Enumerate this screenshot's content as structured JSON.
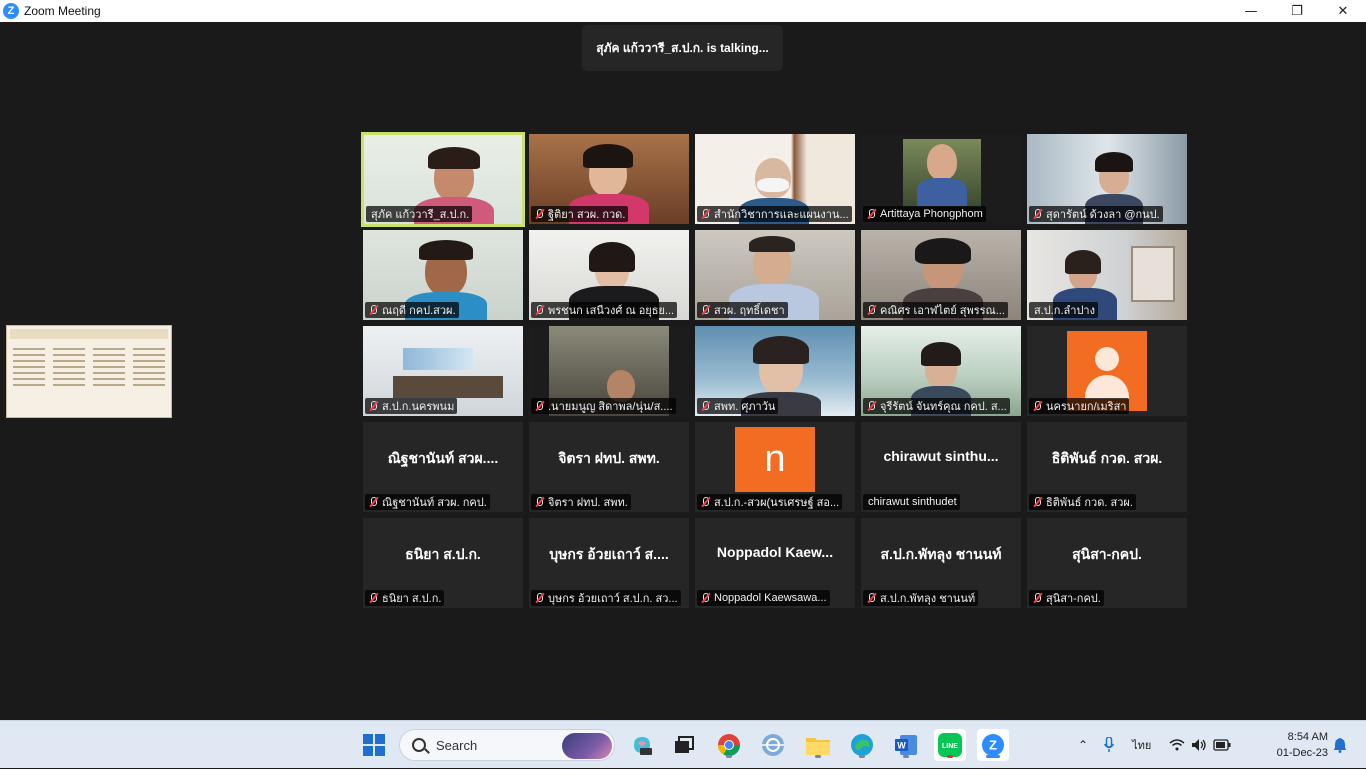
{
  "window": {
    "title": "Zoom Meeting",
    "app_icon_letter": "Z"
  },
  "window_controls": {
    "minimize": "—",
    "maximize": "❐",
    "close": "✕"
  },
  "talking_banner": "สุภัค แก้ววารี_ส.ป.ก. is  talking...",
  "tiles": [
    {
      "name": "สุภัค แก้ววารี_ส.ป.ก.",
      "active": true,
      "muted": false
    },
    {
      "name": "ฐิติยา สวผ. กวด.",
      "muted": true
    },
    {
      "name": "สำนักวิชาการและแผนงาน...",
      "muted": true
    },
    {
      "name": "Artittaya Phongphom",
      "muted": true
    },
    {
      "name": "สุดารัตน์ ด้วงลา @กนป.",
      "muted": true
    },
    {
      "name": "ณฤดี กคป.สวผ.",
      "muted": true
    },
    {
      "name": "พรชนก เสนีวงศ์ ณ อยุธย...",
      "muted": true
    },
    {
      "name": "สวผ. ฤทธิ์เดชา",
      "muted": true
    },
    {
      "name": "คณิศร  เอาฬไตย์ สุพรรณ...",
      "muted": true
    },
    {
      "name": "ส.ป.ก.ลำปาง",
      "muted": false
    },
    {
      "name": "ส.ป.ก.นครพนม",
      "muted": true
    },
    {
      "name": ".นายมนูญ สิดาพล/นุ่น/ส....",
      "muted": true
    },
    {
      "name": "สพท. ศุภาวัน",
      "muted": true
    },
    {
      "name": "จุรีรัตน์ จันทร์คุณ กคป. ส...",
      "muted": true
    },
    {
      "name": "นครนายก/เมริสา",
      "muted": true
    },
    {
      "big": "ณิฐชานันท์ สวผ....",
      "name": "ณิฐชานันท์ สวผ. กคป.",
      "muted": true
    },
    {
      "big": "จิตรา ฝทป. สพท.",
      "name": "จิตรา ฝทป. สพท.",
      "muted": true
    },
    {
      "avatar_letter": "n",
      "name": "ส.ป.ก.-สวผ(นรเศรษฐ์ สอ...",
      "muted": true
    },
    {
      "big": "chirawut  sinthu...",
      "name": "chirawut sinthudet",
      "muted": false
    },
    {
      "big": "ธิติพันธ์ กวด. สวผ.",
      "name": "ธิติพันธ์ กวด. สวผ.",
      "muted": true
    },
    {
      "big": "ธนิยา ส.ป.ก.",
      "name": "ธนิยา ส.ป.ก.",
      "muted": true
    },
    {
      "big": "บุษกร อ้วยเถาว์ ส....",
      "name": "บุษกร อ้วยเถาว์ ส.ป.ก. สว...",
      "muted": true
    },
    {
      "big": "Noppadol  Kaew...",
      "name": "Noppadol Kaewsawa...",
      "muted": true
    },
    {
      "big": "ส.ป.ก.พัทลุง ชานนท์",
      "name": "ส.ป.ก.พัทลุง ชานนท์",
      "muted": true
    },
    {
      "big": "สุนิสา-กคป.",
      "name": "สุนิสา-กคป.",
      "muted": true
    }
  ],
  "taskbar": {
    "search_label": "Search",
    "tray_lang": "ไทย",
    "time": "8:54 AM",
    "date": "01-Dec-23",
    "pinned": [
      "start-icon",
      "copilot-icon",
      "task-view-icon",
      "chrome-icon",
      "network-app-icon",
      "file-explorer-icon",
      "edge-icon",
      "word-icon",
      "line-icon",
      "zoom-icon"
    ],
    "accent": "#2d8cff"
  }
}
